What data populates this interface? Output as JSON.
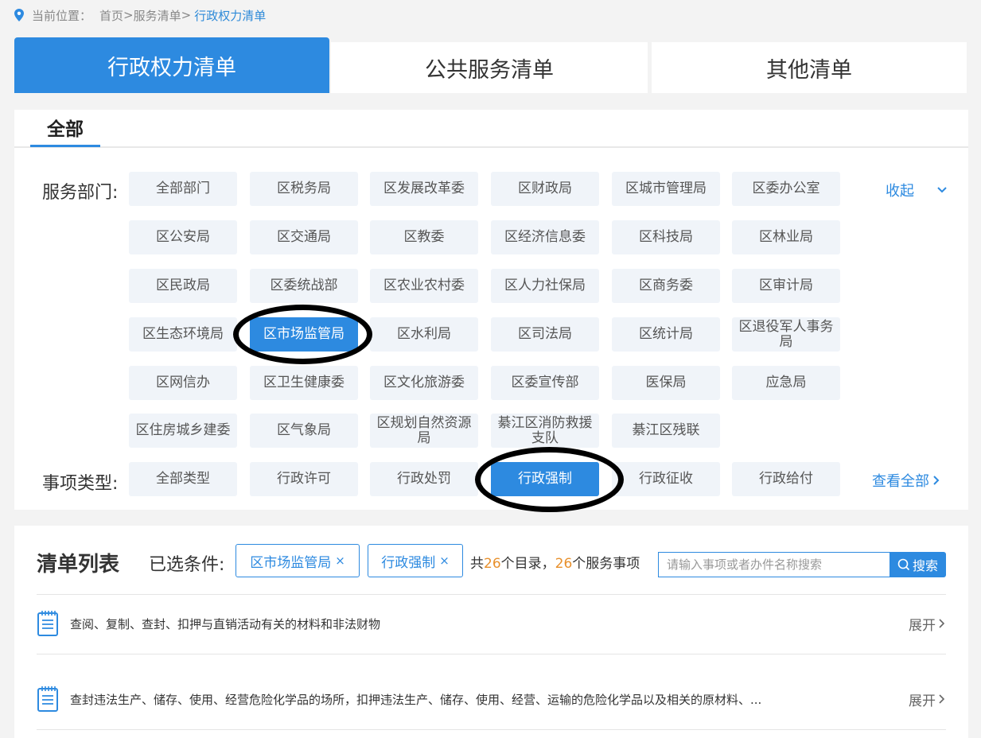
{
  "breadcrumb": {
    "label": "当前位置：",
    "home": "首页",
    "sep": ">",
    "services": "服务清单",
    "current": "行政权力清单"
  },
  "tabs": [
    {
      "label": "行政权力清单",
      "active": true
    },
    {
      "label": "公共服务清单",
      "active": false
    },
    {
      "label": "其他清单",
      "active": false
    }
  ],
  "filter": {
    "all_tab": "全部",
    "dept_label": "服务部门:",
    "collapse_label": "收起",
    "depts": [
      "全部部门",
      "区税务局",
      "区发展改革委",
      "区财政局",
      "区城市管理局",
      "区委办公室",
      "区公安局",
      "区交通局",
      "区教委",
      "区经济信息委",
      "区科技局",
      "区林业局",
      "区民政局",
      "区委统战部",
      "区农业农村委",
      "区人力社保局",
      "区商务委",
      "区审计局",
      "区生态环境局",
      "区市场监管局",
      "区水利局",
      "区司法局",
      "区统计局",
      "区退役军人事务局",
      "区网信办",
      "区卫生健康委",
      "区文化旅游委",
      "区委宣传部",
      "医保局",
      "应急局",
      "区住房城乡建委",
      "区气象局",
      "区规划自然资源局",
      "綦江区消防救援支队",
      "綦江区残联"
    ],
    "selected_dept": "区市场监管局",
    "type_label": "事项类型:",
    "types": [
      "全部类型",
      "行政许可",
      "行政处罚",
      "行政强制",
      "行政征收",
      "行政给付"
    ],
    "selected_type": "行政强制",
    "view_all": "查看全部"
  },
  "list": {
    "title": "清单列表",
    "cond_label": "已选条件:",
    "tags": [
      "区市场监管局",
      "行政强制"
    ],
    "count": {
      "pre": "共",
      "n1": "26",
      "mid": "个目录，",
      "n2": "26",
      "post": "个服务事项"
    },
    "search_placeholder": "请输入事项或者办件名称搜索",
    "search_btn": "搜索",
    "items": [
      {
        "text": "查阅、复制、查封、扣押与直销活动有关的材料和非法财物",
        "action": "展开"
      },
      {
        "text": "查封违法生产、储存、使用、经营危险化学品的场所，扣押违法生产、储存、使用、经营、运输的危险化学品以及相关的原材料、...",
        "action": "展开"
      }
    ]
  },
  "colors": {
    "accent": "#2d8ae0",
    "highlight_num": "#e8902c",
    "annotation_ring": "#000000"
  }
}
